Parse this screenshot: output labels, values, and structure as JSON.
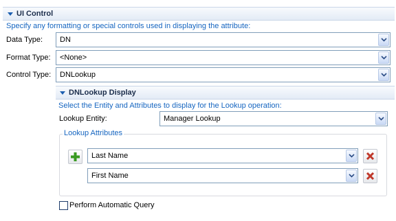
{
  "ui_control": {
    "title": "UI Control",
    "description": "Specify any formatting or special controls used in displaying the attribute:",
    "data_type": {
      "label": "Data Type:",
      "value": "DN"
    },
    "format_type": {
      "label": "Format Type:",
      "value": "<None>"
    },
    "control_type": {
      "label": "Control Type:",
      "value": "DNLookup"
    }
  },
  "dnlookup_display": {
    "title": "DNLookup Display",
    "description": "Select the Entity and Attributes to display for the Lookup operation:",
    "lookup_entity": {
      "label": "Lookup Entity:",
      "value": "Manager Lookup"
    },
    "lookup_attributes": {
      "title": "Lookup Attributes",
      "rows": [
        {
          "value": "Last Name"
        },
        {
          "value": "First Name"
        }
      ]
    },
    "perform_query": {
      "label": "Perform Automatic Query",
      "checked": false
    }
  },
  "icons": {
    "expand": "triangle-down-icon",
    "add": "green-plus-icon",
    "remove": "red-x-icon",
    "dropdown": "chevron-down-icon"
  },
  "colors": {
    "description_text": "#1565c0",
    "header_bg": "#e3ebf6",
    "add_icon": "#3a9a22",
    "remove_icon": "#c0392b"
  }
}
